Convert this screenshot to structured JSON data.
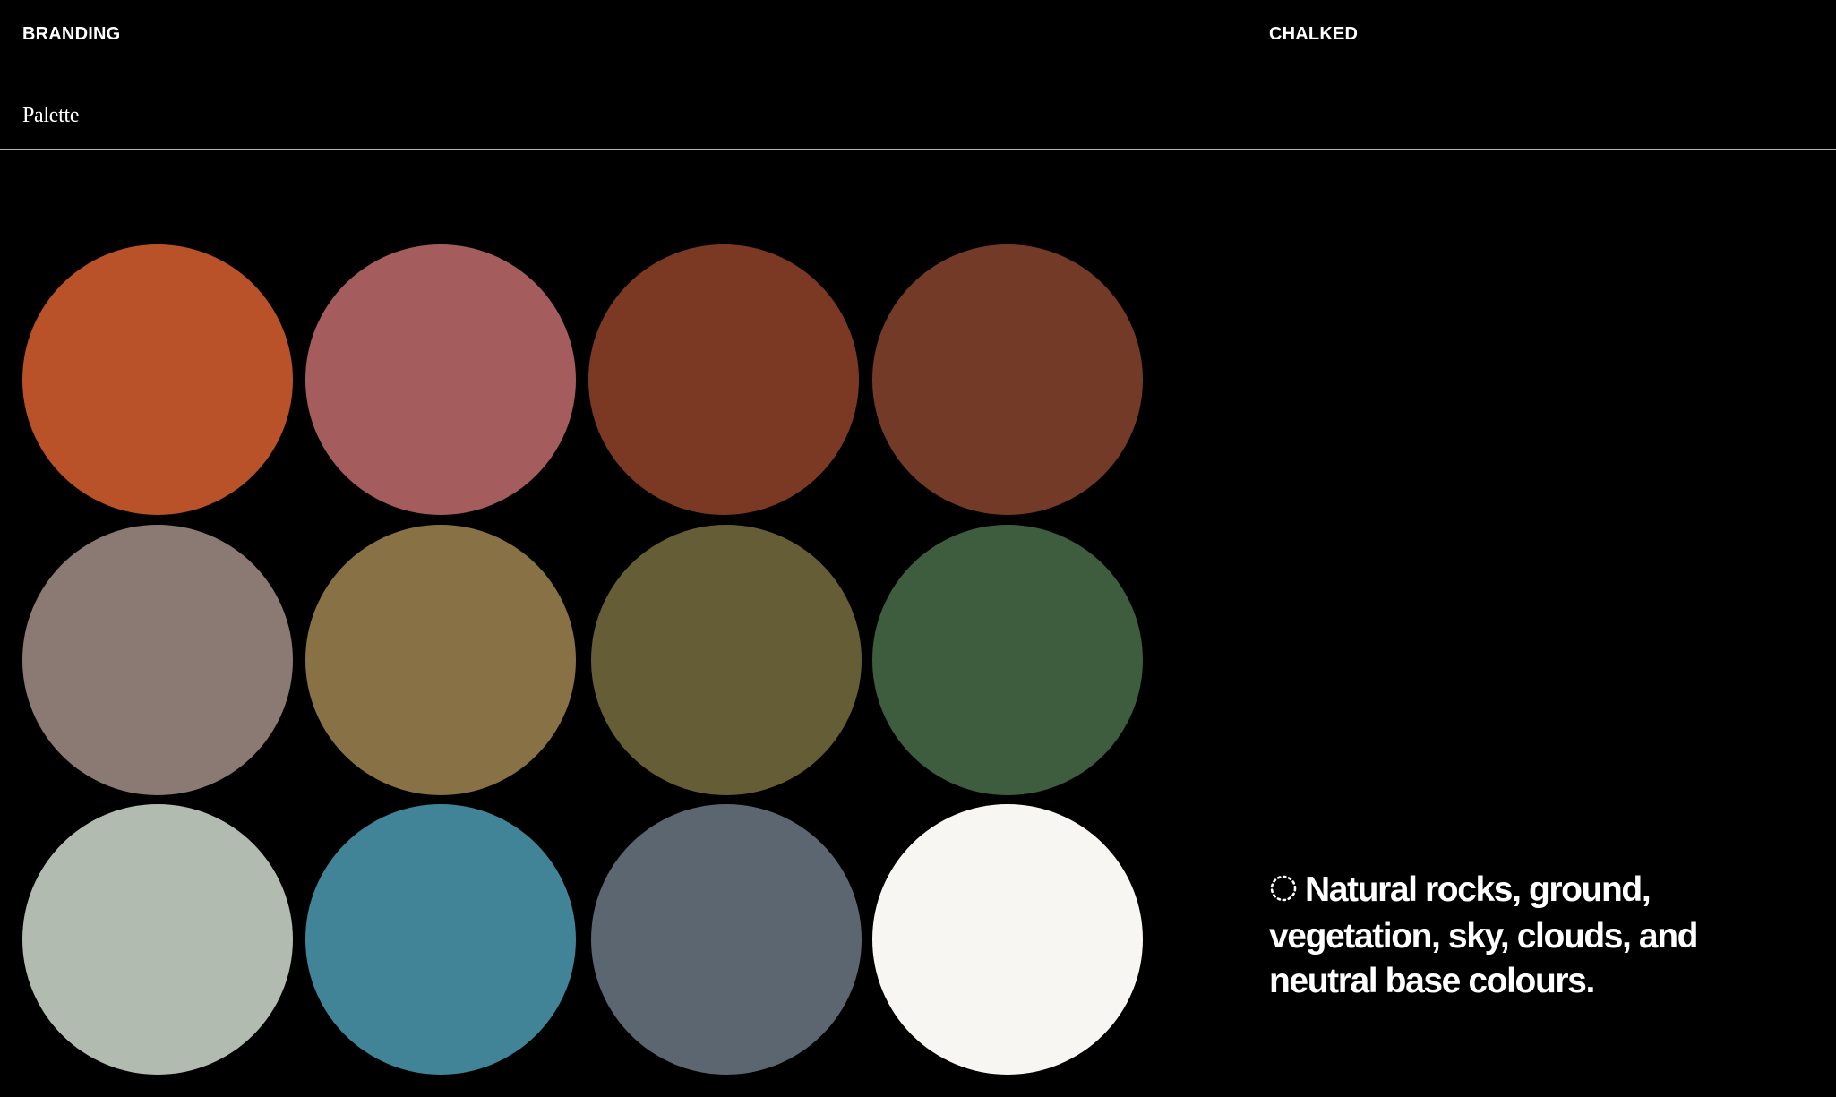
{
  "header": {
    "left_label": "BRANDING",
    "right_label": "CHALKED"
  },
  "section": {
    "title": "Palette"
  },
  "palette": {
    "colors": [
      "#B95129",
      "#A55C5C",
      "#7B3924",
      "#733A28",
      "#8A7A73",
      "#887245",
      "#655D35",
      "#3E5C3E",
      "#B2BBAF",
      "#418498",
      "#5B6670",
      "#F7F6F2"
    ]
  },
  "caption": {
    "icon": "dotted-circle-icon",
    "text": "Natural rocks, ground, vegetation, sky, clouds, and neutral base colours."
  }
}
